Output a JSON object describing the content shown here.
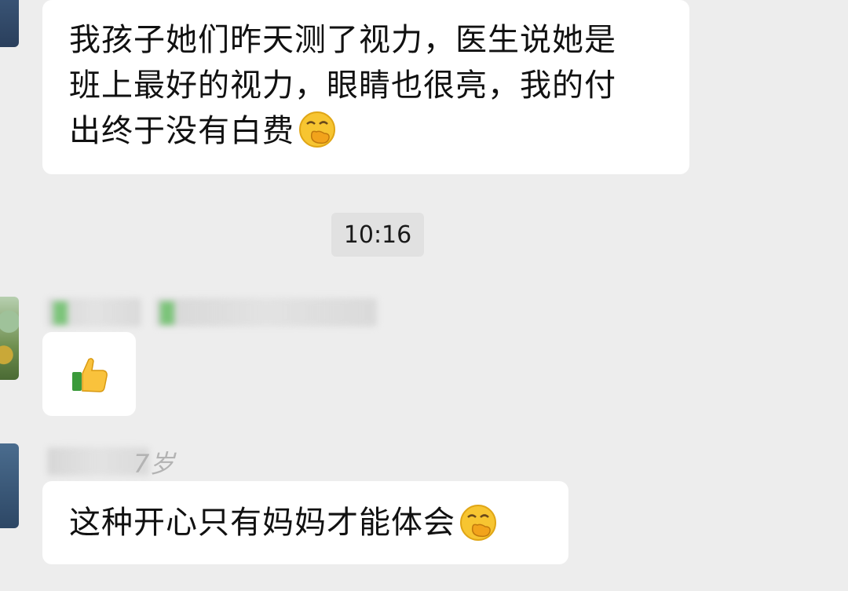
{
  "messages": {
    "first": {
      "lines": [
        "我孩子她们昨天测了视力，医生说她是",
        "班上最好的视力，眼睛也很亮，我的付",
        "出终于没有白费"
      ],
      "emoji": "hand-over-mouth-face"
    },
    "timestamp": "10:16",
    "second": {
      "emoji": "thumbs-up-icon"
    },
    "third": {
      "sender_partial": "7岁",
      "text": "这种开心只有妈妈才能体会",
      "emoji": "hand-over-mouth-face"
    }
  },
  "colors": {
    "background": "#ededed",
    "bubble": "#ffffff",
    "timestamp_bg": "#e1e1e1"
  }
}
